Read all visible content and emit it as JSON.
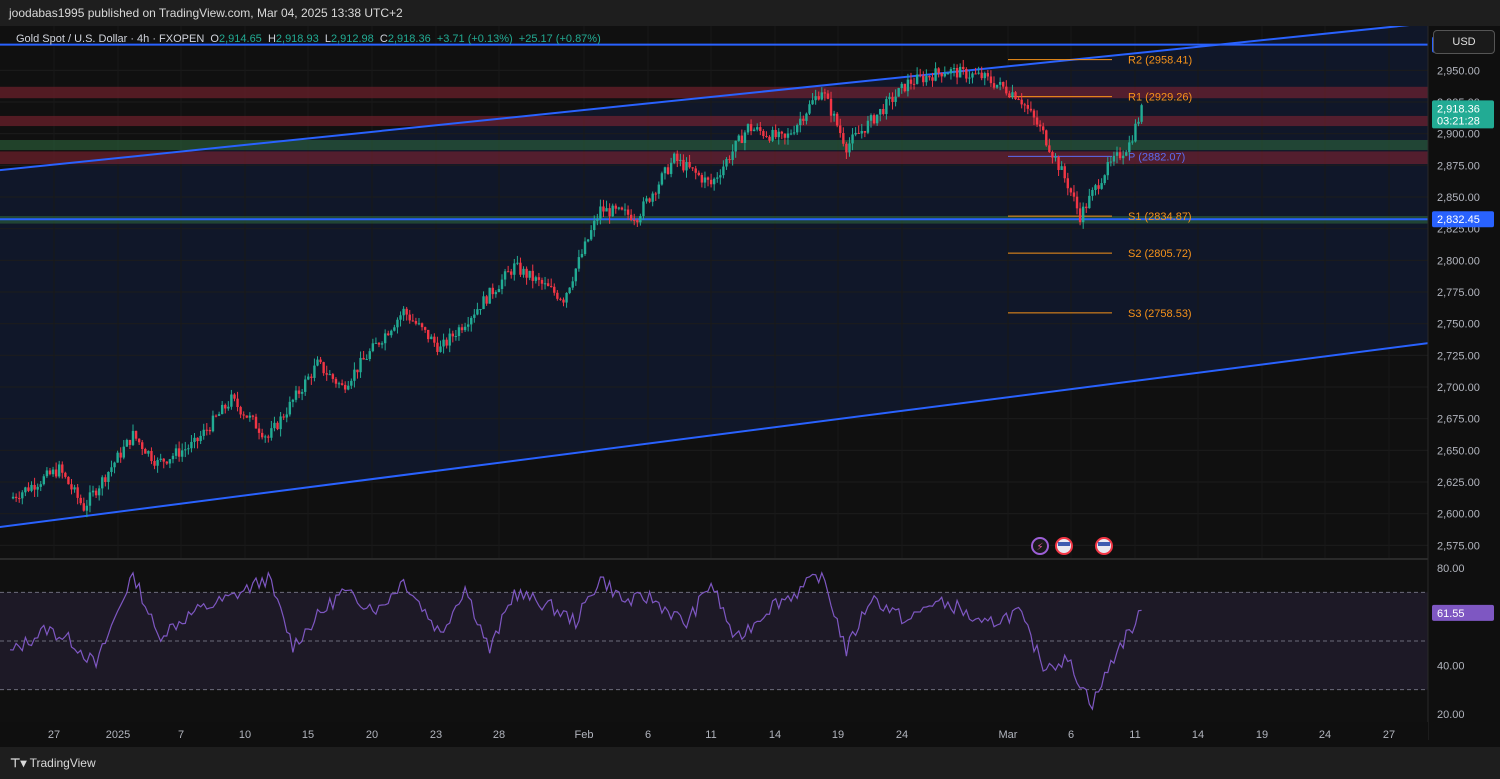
{
  "header": {
    "published_text": "joodabas1995 published on TradingView.com, Mar 04, 2025 13:38 UTC+2"
  },
  "legend": {
    "symbol": "Gold Spot / U.S. Dollar · 4h · FXOPEN",
    "o_label": "O",
    "o": "2,914.65",
    "h_label": "H",
    "h": "2,918.93",
    "l_label": "L",
    "l": "2,912.98",
    "c_label": "C",
    "c": "2,918.36",
    "change": "+3.71 (+0.13%)",
    "change2": "+25.17 (+0.87%)"
  },
  "currency_button": "USD",
  "footer": {
    "brand": "TradingView"
  },
  "colors": {
    "up": "#22ab94",
    "down": "#f23645",
    "channel": "#2962ff",
    "pivot_orange": "#f7931a",
    "pivot_blue": "#5b6cf0",
    "rsi": "#7e57c2"
  },
  "chart_data": {
    "type": "candlestick",
    "title": "Gold Spot / U.S. Dollar · 4h · FXOPEN",
    "ylim": [
      2565,
      2985
    ],
    "y_ticks": [
      2575,
      2600,
      2625,
      2650,
      2675,
      2700,
      2725,
      2750,
      2775,
      2800,
      2825,
      2850,
      2875,
      2900,
      2925,
      2950
    ],
    "y_tick_labels": [
      "2,575.00",
      "2,600.00",
      "2,625.00",
      "2,650.00",
      "2,675.00",
      "2,700.00",
      "2,725.00",
      "2,750.00",
      "2,775.00",
      "2,800.00",
      "2,825.00",
      "2,850.00",
      "2,875.00",
      "2,900.00",
      "2,925.00",
      "2,950.00"
    ],
    "x_tick_labels": [
      "27",
      "2025",
      "7",
      "10",
      "15",
      "20",
      "23",
      "28",
      "Feb",
      "6",
      "11",
      "14",
      "19",
      "24",
      "Mar",
      "6",
      "11",
      "14",
      "19",
      "24",
      "27"
    ],
    "price_path": [
      [
        0,
        2612
      ],
      [
        4,
        2635
      ],
      [
        6,
        2605
      ],
      [
        10,
        2662
      ],
      [
        12,
        2640
      ],
      [
        15,
        2655
      ],
      [
        18,
        2690
      ],
      [
        21,
        2660
      ],
      [
        25,
        2718
      ],
      [
        27,
        2700
      ],
      [
        32,
        2760
      ],
      [
        35,
        2730
      ],
      [
        41,
        2795
      ],
      [
        45,
        2770
      ],
      [
        48,
        2840
      ],
      [
        51,
        2835
      ],
      [
        54,
        2880
      ],
      [
        57,
        2860
      ],
      [
        60,
        2905
      ],
      [
        63,
        2895
      ],
      [
        66,
        2935
      ],
      [
        68,
        2890
      ],
      [
        73,
        2940
      ],
      [
        76,
        2950
      ],
      [
        79,
        2945
      ],
      [
        82,
        2930
      ],
      [
        84,
        2900
      ],
      [
        86,
        2860
      ],
      [
        87,
        2835
      ],
      [
        89,
        2870
      ],
      [
        91,
        2892
      ],
      [
        92,
        2918.36
      ]
    ],
    "current_price": "2,918.36",
    "countdown": "03:21:28",
    "price_tags": [
      {
        "value": 2970.25,
        "label": "2,970.25"
      },
      {
        "value": 2832.45,
        "label": "2,832.45"
      }
    ],
    "pivots": [
      {
        "label": "R2 (2958.41)",
        "value": 2958.41,
        "color": "orange"
      },
      {
        "label": "R1 (2929.26)",
        "value": 2929.26,
        "color": "orange"
      },
      {
        "label": "P (2882.07)",
        "value": 2882.07,
        "color": "blue"
      },
      {
        "label": "S1 (2834.87)",
        "value": 2834.87,
        "color": "orange"
      },
      {
        "label": "S2 (2805.72)",
        "value": 2805.72,
        "color": "orange"
      },
      {
        "label": "S3 (2758.53)",
        "value": 2758.53,
        "color": "orange"
      }
    ],
    "zones": [
      {
        "low": 2928,
        "high": 2937,
        "color": "red"
      },
      {
        "low": 2906,
        "high": 2914,
        "color": "red"
      },
      {
        "low": 2887,
        "high": 2895,
        "color": "green"
      },
      {
        "low": 2876,
        "high": 2886,
        "color": "red"
      },
      {
        "low": 2829,
        "high": 2835,
        "color": "green"
      }
    ],
    "horizontal_lines": [
      2970.25,
      2832.45
    ],
    "channel": {
      "upper": [
        [
          -2,
          2870
        ],
        [
          118,
          2990
        ]
      ],
      "lower": [
        [
          -2,
          2588
        ],
        [
          118,
          2738
        ]
      ]
    },
    "rsi": {
      "ylim": [
        20,
        80
      ],
      "tick_labels": [
        "80.00",
        "40.00",
        "20.00"
      ],
      "tick_values": [
        80,
        40,
        20
      ],
      "levels": [
        70,
        50,
        30
      ],
      "current_label": "61.55",
      "current": 61.55,
      "path": [
        [
          0,
          45
        ],
        [
          3,
          55
        ],
        [
          5,
          50
        ],
        [
          7,
          40
        ],
        [
          10,
          78
        ],
        [
          12,
          52
        ],
        [
          15,
          62
        ],
        [
          18,
          68
        ],
        [
          21,
          76
        ],
        [
          23,
          48
        ],
        [
          25,
          60
        ],
        [
          27,
          70
        ],
        [
          30,
          63
        ],
        [
          32,
          75
        ],
        [
          35,
          53
        ],
        [
          37,
          72
        ],
        [
          39,
          46
        ],
        [
          41,
          70
        ],
        [
          44,
          64
        ],
        [
          46,
          58
        ],
        [
          48,
          76
        ],
        [
          50,
          66
        ],
        [
          52,
          68
        ],
        [
          55,
          57
        ],
        [
          57,
          74
        ],
        [
          59,
          50
        ],
        [
          62,
          65
        ],
        [
          64,
          70
        ],
        [
          66,
          78
        ],
        [
          68,
          46
        ],
        [
          70,
          68
        ],
        [
          73,
          58
        ],
        [
          75,
          66
        ],
        [
          77,
          64
        ],
        [
          79,
          56
        ],
        [
          82,
          62
        ],
        [
          84,
          40
        ],
        [
          86,
          42
        ],
        [
          88,
          24
        ],
        [
          90,
          46
        ],
        [
          92,
          61.55
        ]
      ]
    }
  }
}
